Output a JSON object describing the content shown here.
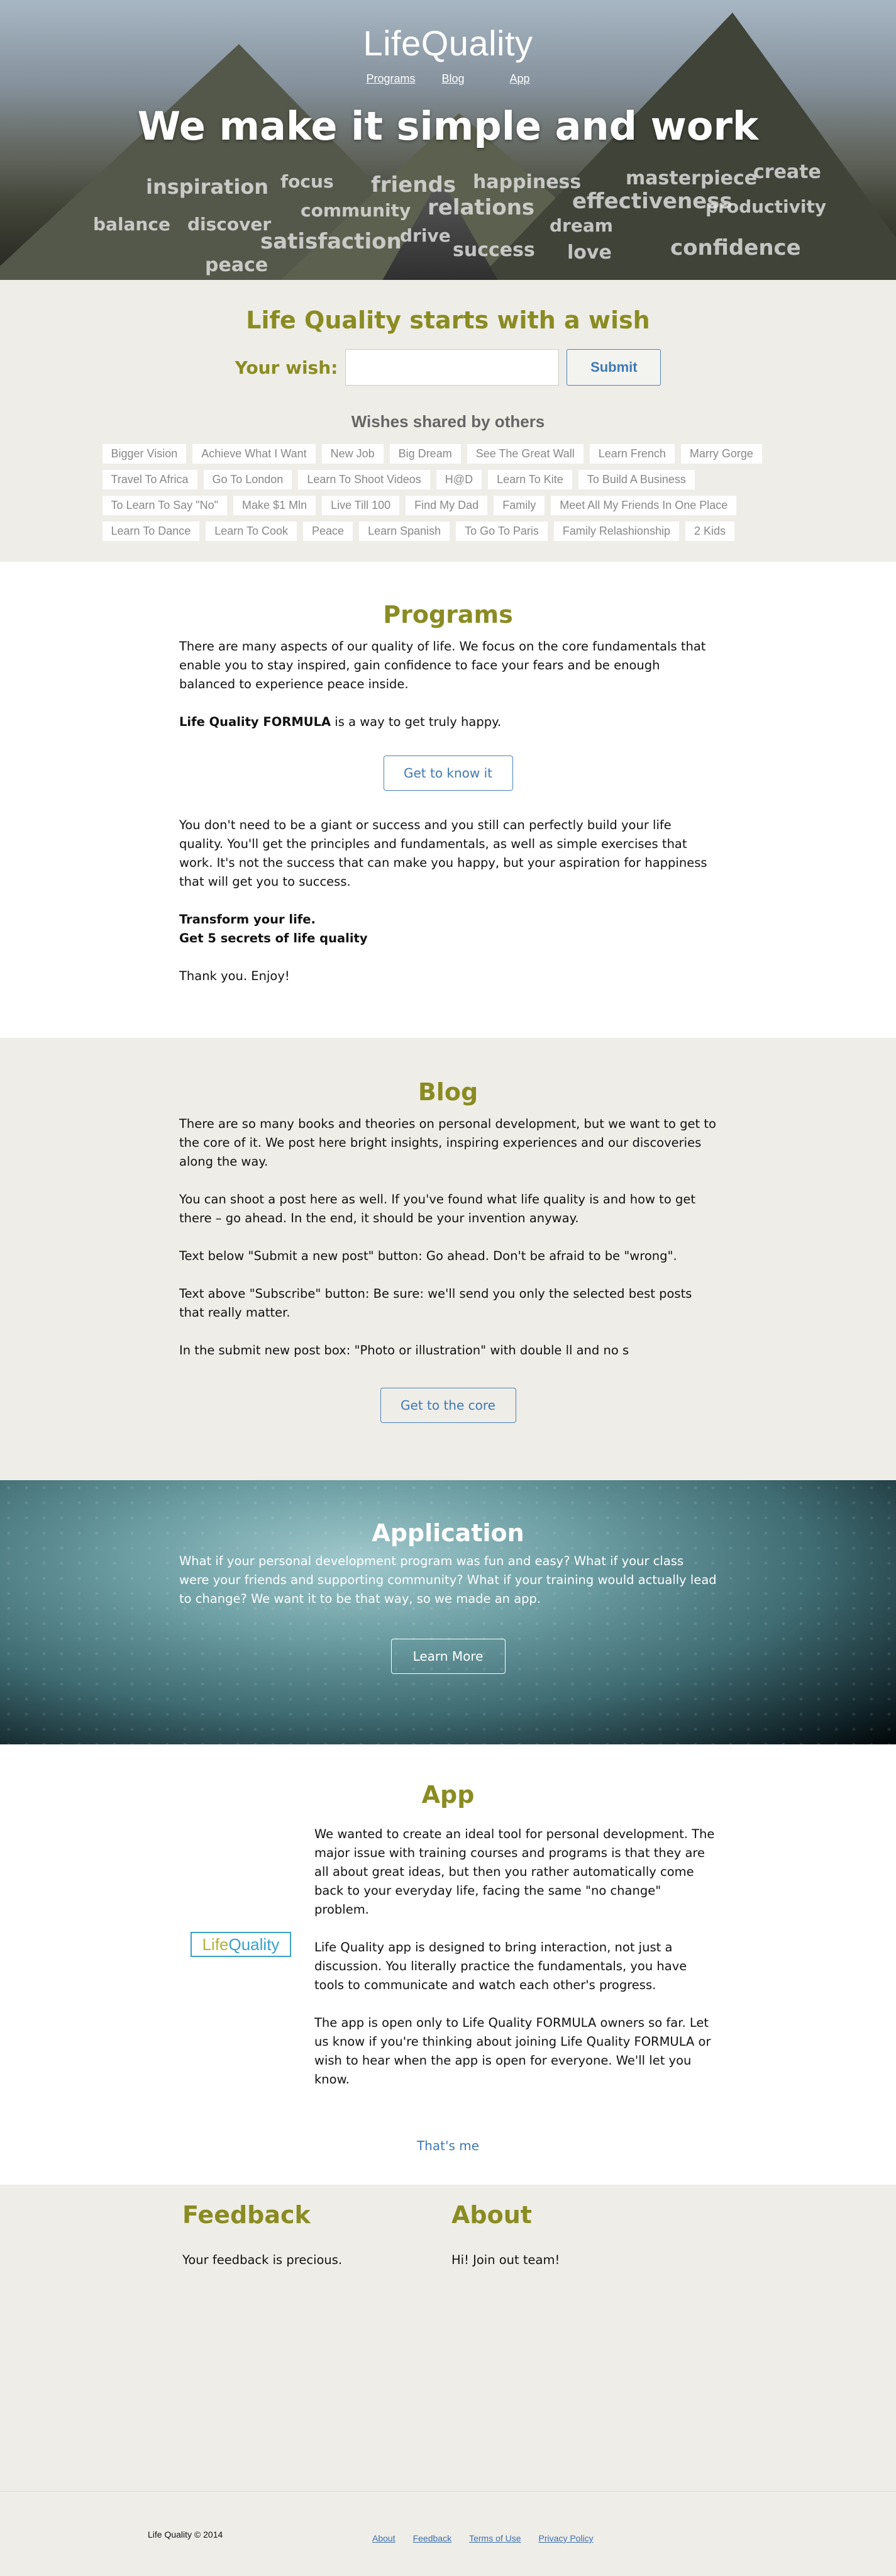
{
  "hero": {
    "logo": "LifeQuality",
    "nav": [
      "Programs",
      "Blog",
      "App"
    ],
    "title": "We make it simple and work",
    "words": [
      "inspiration",
      "focus",
      "friends",
      "happiness",
      "masterpiece",
      "create",
      "balance",
      "discover",
      "community",
      "relations",
      "effectiveness",
      "productivity",
      "dream",
      "satisfaction",
      "drive",
      "success",
      "love",
      "confidence",
      "peace"
    ]
  },
  "wish": {
    "title": "Life Quality starts with a wish",
    "label": "Your wish:",
    "input_value": "",
    "submit": "Submit",
    "shared_title": "Wishes shared by others",
    "tags": [
      "Bigger Vision",
      "Achieve What I Want",
      "New Job",
      "Big Dream",
      "See The Great Wall",
      "Learn French",
      "Marry Gorge",
      "Travel To Africa",
      "Go To London",
      "Learn To Shoot Videos",
      "H@D",
      "Learn To Kite",
      "To Build A Business",
      "To Learn To Say \"No\"",
      "Make $1 Mln",
      "Live Till 100",
      "Find My Dad",
      "Family",
      "Meet All My Friends In One Place",
      "Learn To Dance",
      "Learn To Cook",
      "Peace",
      "Learn Spanish",
      "To Go To Paris",
      "Family Relashionship",
      "2 Kids"
    ]
  },
  "programs": {
    "title": "Programs",
    "p1": "There are many aspects of our quality of life. We focus on the core fundamentals that enable you to stay inspired, gain confidence to face your fears and be enough balanced to experience peace inside.",
    "formula_bold": "Life Quality FORMULA",
    "formula_rest": " is a way to get truly happy.",
    "button": "Get to know it",
    "p2": "You don't need to be a giant or success and you still can perfectly build your life quality. You'll get the principles and fundamentals, as well as simple exercises that work. It's not the success that can make you happy, but your aspiration for happiness that will get you to success.",
    "bold1": "Transform your life.",
    "bold2": "Get 5 secrets of life quality",
    "thanks": "Thank you. Enjoy!"
  },
  "blog": {
    "title": "Blog",
    "p1": "There are so many books and theories on personal development, but we want to get to the core of it. We post here bright insights, inspiring experiences and our discoveries along the way.",
    "p2": "You can shoot a post here as well. If you've found what life quality is and how to get there – go ahead. In the end, it should be your invention anyway.",
    "p3": "Text below \"Submit a new post\" button: Go ahead. Don't be afraid to be \"wrong\".",
    "p4": "Text above \"Subscribe\" button: Be sure: we'll send you only the selected best posts that really matter.",
    "p5": "In the submit new post box: \"Photo or illustration\" with double ll and no s",
    "button": "Get to the core"
  },
  "application": {
    "title": "Application",
    "p1": "What if your personal development program was fun and easy? What if your class were your friends and supporting community? What if your training would actually lead to change? We want it to be that way, so we made an app.",
    "button": "Learn More"
  },
  "app": {
    "title": "App",
    "logo_life": "Life",
    "logo_quality": "Quality",
    "p1": "We wanted to create an ideal tool for personal development. The major issue with training courses and programs is that they are all about great ideas, but then you rather automatically come back to your everyday life, facing the same \"no change\" problem.",
    "p2": "Life Quality app is designed to bring interaction, not just a discussion. You literally practice the fundamentals, you have tools to communicate and watch each other's progress.",
    "p3": "The app is open only to Life Quality FORMULA owners so far. Let us know if you're thinking about joining Life Quality FORMULA or wish to hear when the app is open for everyone. We'll let you know.",
    "button": "That's me"
  },
  "feedback": {
    "title": "Feedback",
    "text": "Your feedback is precious."
  },
  "about": {
    "title": "About",
    "text": "Hi! Join out team!"
  },
  "footer": {
    "copyright": "Life Quality © 2014",
    "links": [
      "About",
      "Feedback",
      "Terms of Use",
      "Privacy Policy"
    ]
  }
}
